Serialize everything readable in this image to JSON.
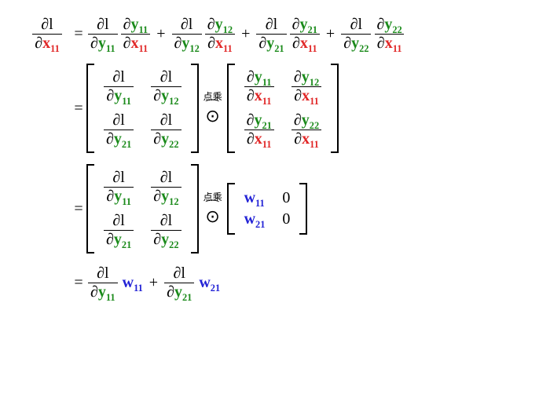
{
  "sym": {
    "partial": "∂",
    "l": "l",
    "plus": "+",
    "eq": "=",
    "zero": "0",
    "odot": "⊙",
    "brace": "⏜"
  },
  "labels": {
    "hadamard": "点乘"
  },
  "vars": {
    "x11": "x",
    "x11_sub": "11",
    "y11": "y",
    "y11_sub": "11",
    "y12": "y",
    "y12_sub": "12",
    "y21": "y",
    "y21_sub": "21",
    "y22": "y",
    "y22_sub": "22",
    "w11": "w",
    "w11_sub": "11",
    "w21": "w",
    "w21_sub": "21"
  }
}
